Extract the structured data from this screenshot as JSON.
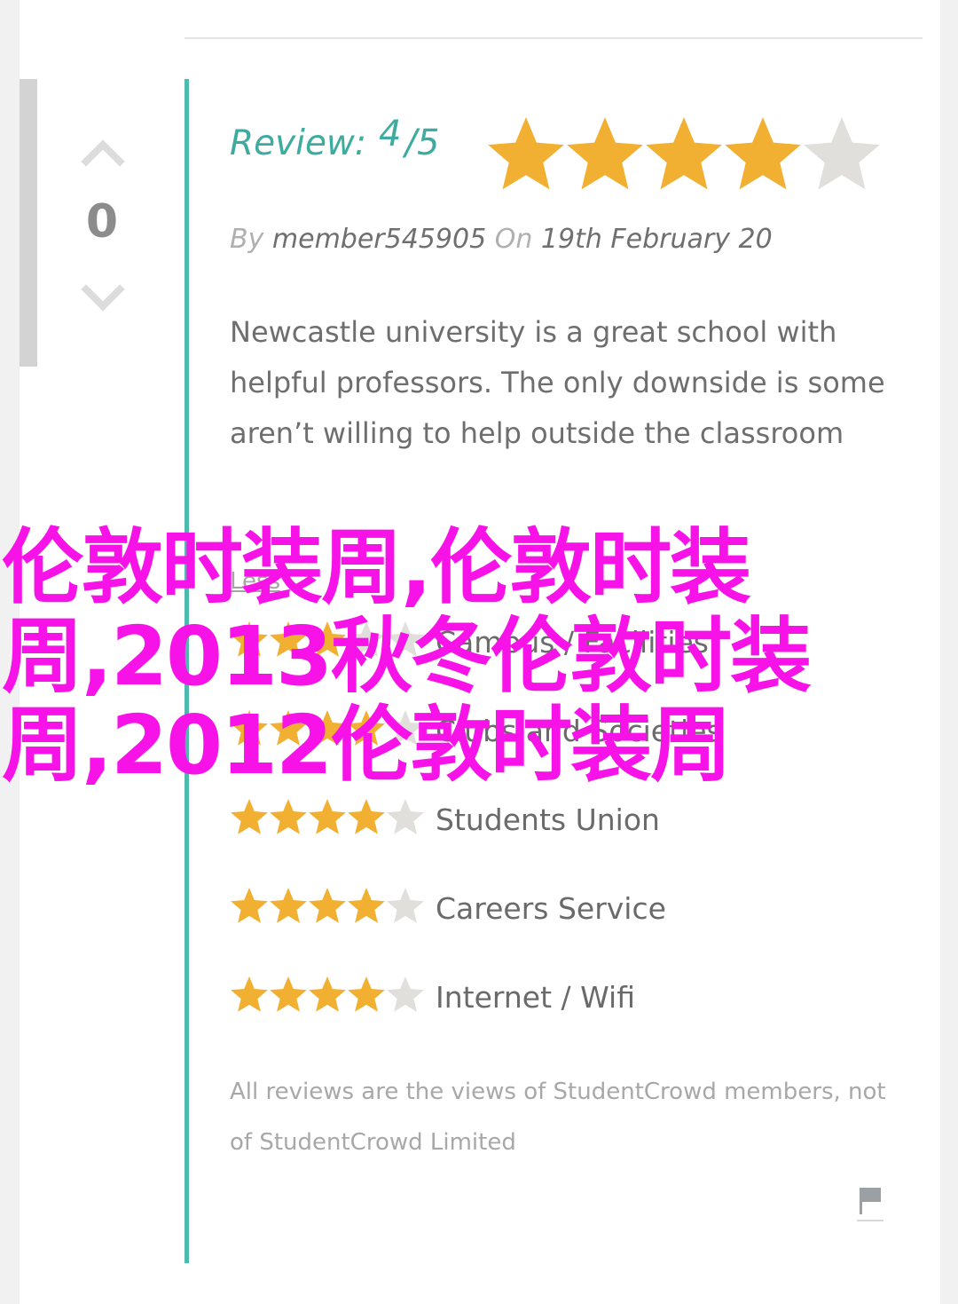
{
  "vote": {
    "count": "0"
  },
  "review": {
    "label": "Review:",
    "score": "4",
    "slash": "/",
    "out_of": "5",
    "rating": 4,
    "max_rating": 5,
    "by_label": "By",
    "author": "member545905",
    "on_label": "On",
    "date": "19th February 20",
    "text": "Newcastle university is a great school with helpful professors. The only downside is some aren’t willing to help outside the classroom",
    "less_link": "Less"
  },
  "categories": [
    {
      "label": "Campus / Facilities",
      "rating": 3
    },
    {
      "label": "Clubs and Societies",
      "rating": 4
    },
    {
      "label": "Students Union",
      "rating": 4
    },
    {
      "label": "Careers Service",
      "rating": 4
    },
    {
      "label": "Internet / Wifi",
      "rating": 4
    }
  ],
  "disclaimer": "All reviews are the views of StudentCrowd members, not of StudentCrowd Limited",
  "watermark": {
    "text": "伦敦时装周,伦敦时装周,2013秋冬伦敦时装周,2012伦敦时装周"
  },
  "colors": {
    "star_filled": "#f2b032",
    "star_empty": "#e0dfdc",
    "accent_teal": "#4eb9ad",
    "watermark": "#f713e8"
  }
}
